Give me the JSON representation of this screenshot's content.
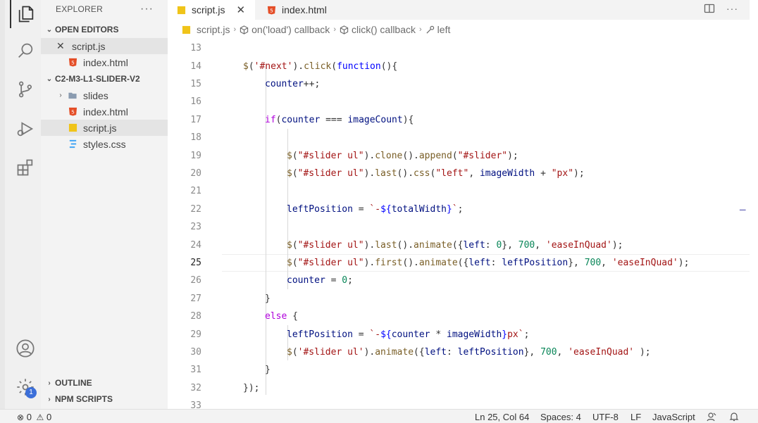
{
  "sidebar": {
    "header": "EXPLORER",
    "more": "···",
    "open_editors_title": "OPEN EDITORS",
    "open_editors": [
      {
        "label": "script.js",
        "icon": "js-file-icon"
      },
      {
        "label": "index.html",
        "icon": "html-file-icon"
      }
    ],
    "folder_title": "C2-M3-L1-SLIDER-V2",
    "files": [
      {
        "label": "slides",
        "icon": "folder-icon"
      },
      {
        "label": "index.html",
        "icon": "html-file-icon"
      },
      {
        "label": "script.js",
        "icon": "js-file-icon"
      },
      {
        "label": "styles.css",
        "icon": "css-file-icon"
      }
    ],
    "outline_title": "OUTLINE",
    "npm_title": "NPM SCRIPTS"
  },
  "tabs": [
    {
      "label": "script.js",
      "icon": "js-file-icon",
      "active": true
    },
    {
      "label": "index.html",
      "icon": "html-file-icon",
      "active": false
    }
  ],
  "breadcrumb": [
    "script.js",
    "on('load') callback",
    "click() callback",
    "left"
  ],
  "editor": {
    "current_line": 25,
    "line_numbers": [
      "13",
      "14",
      "15",
      "16",
      "17",
      "18",
      "19",
      "20",
      "21",
      "22",
      "23",
      "24",
      "25",
      "26",
      "27",
      "28",
      "29",
      "30",
      "31",
      "32",
      "33"
    ]
  },
  "statusbar": {
    "errors": "0",
    "warnings": "0",
    "position": "Ln 25, Col 64",
    "spaces": "Spaces: 4",
    "encoding": "UTF-8",
    "eol": "LF",
    "language": "JavaScript"
  },
  "activity": {
    "settings_badge": "1"
  },
  "colors": {
    "accent": "#3c6fd9",
    "keyword": "#af00db",
    "function": "#795e26",
    "string": "#a31515",
    "number": "#098658"
  }
}
